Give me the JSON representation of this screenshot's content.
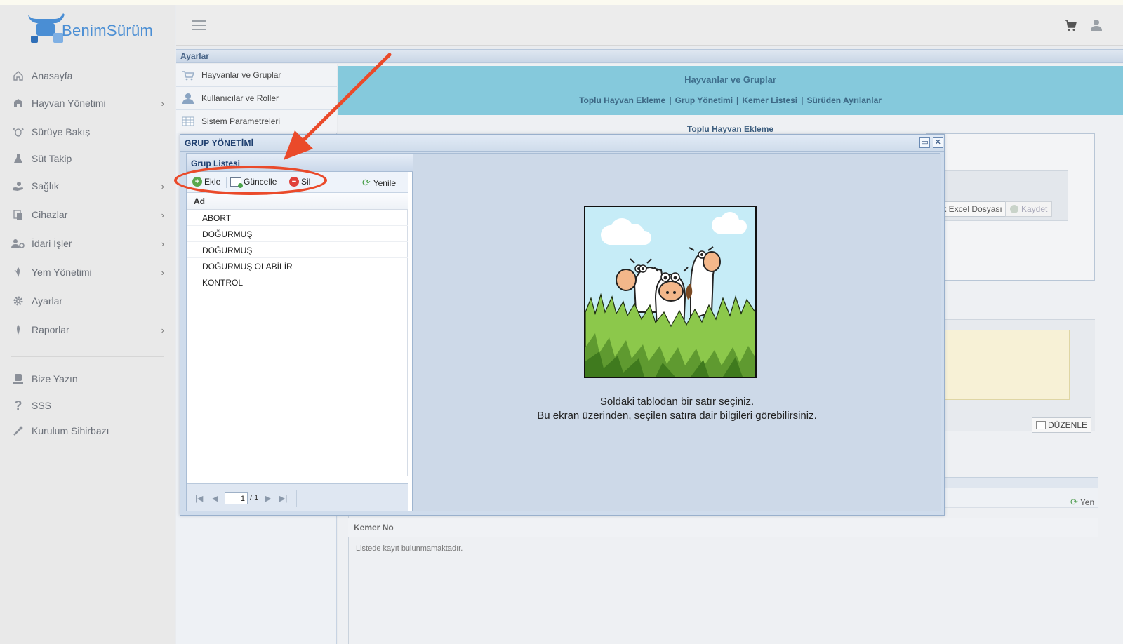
{
  "app": {
    "logo_text": "BenimSürüm"
  },
  "sidebar": {
    "items": [
      {
        "label": "Anasayfa",
        "icon": "home-icon",
        "chevron": false
      },
      {
        "label": "Hayvan Yönetimi",
        "icon": "barn-icon",
        "chevron": true
      },
      {
        "label": "Sürüye Bakış",
        "icon": "cow-head-icon",
        "chevron": false
      },
      {
        "label": "Süt Takip",
        "icon": "flask-icon",
        "chevron": false
      },
      {
        "label": "Sağlık",
        "icon": "health-hand-icon",
        "chevron": true
      },
      {
        "label": "Cihazlar",
        "icon": "devices-icon",
        "chevron": true
      },
      {
        "label": "İdari İşler",
        "icon": "users-cog-icon",
        "chevron": true
      },
      {
        "label": "Yem Yönetimi",
        "icon": "feed-icon",
        "chevron": true
      },
      {
        "label": "Ayarlar",
        "icon": "gear-icon",
        "chevron": false
      },
      {
        "label": "Raporlar",
        "icon": "report-icon",
        "chevron": true
      }
    ],
    "secondary": [
      {
        "label": "Bize Yazın",
        "icon": "contact-icon"
      },
      {
        "label": "SSS",
        "icon": "question-icon"
      },
      {
        "label": "Kurulum Sihirbazı",
        "icon": "wand-icon"
      }
    ],
    "chevron_glyph": "›"
  },
  "ayarlar": {
    "title": "Ayarlar",
    "menu": [
      {
        "label": "Hayvanlar ve Gruplar",
        "icon": "cart-animals-icon"
      },
      {
        "label": "Kullanıcılar ve Roller",
        "icon": "user-icon"
      },
      {
        "label": "Sistem Parametreleri",
        "icon": "table-icon"
      }
    ]
  },
  "content": {
    "title": "Hayvanlar ve Gruplar",
    "links": [
      "Toplu Hayvan Ekleme",
      "Grup Yönetimi",
      "Kemer Listesi",
      "Sürüden Ayrılanlar"
    ],
    "link_separator": "|",
    "section_title": "Toplu Hayvan Ekleme",
    "excel_button": "nek Excel Dosyası",
    "kaydet_button": "Kaydet",
    "duzenle_button": "DÜZENLE",
    "yenile_label": "Yen",
    "kemer_header": "Kemer No",
    "empty_message": "Listede kayıt bulunmamaktadır."
  },
  "modal": {
    "title": "GRUP YÖNETİMİ",
    "maximize_glyph": "▭",
    "close_glyph": "✕",
    "grid": {
      "title": "Grup Listesi",
      "buttons": {
        "add": "Ekle",
        "update": "Güncelle",
        "delete": "Sil",
        "refresh": "Yenile"
      },
      "column": "Ad",
      "rows": [
        "ABORT",
        "DOĞURMUŞ",
        "DOĞURMUŞ",
        "DOĞURMUŞ OLABİLİR",
        "KONTROL"
      ],
      "pager": {
        "current": "1",
        "total": "/ 1"
      }
    },
    "detail": {
      "line1": "Soldaki tablodan bir satır seçiniz.",
      "line2": "Bu ekran üzerinden, seçilen satıra dair bilgileri görebilirsiniz."
    }
  },
  "colors": {
    "accent_header": "#85c9dc",
    "annotation": "#ea4a2a",
    "logo_blue": "#4a8ed4"
  }
}
